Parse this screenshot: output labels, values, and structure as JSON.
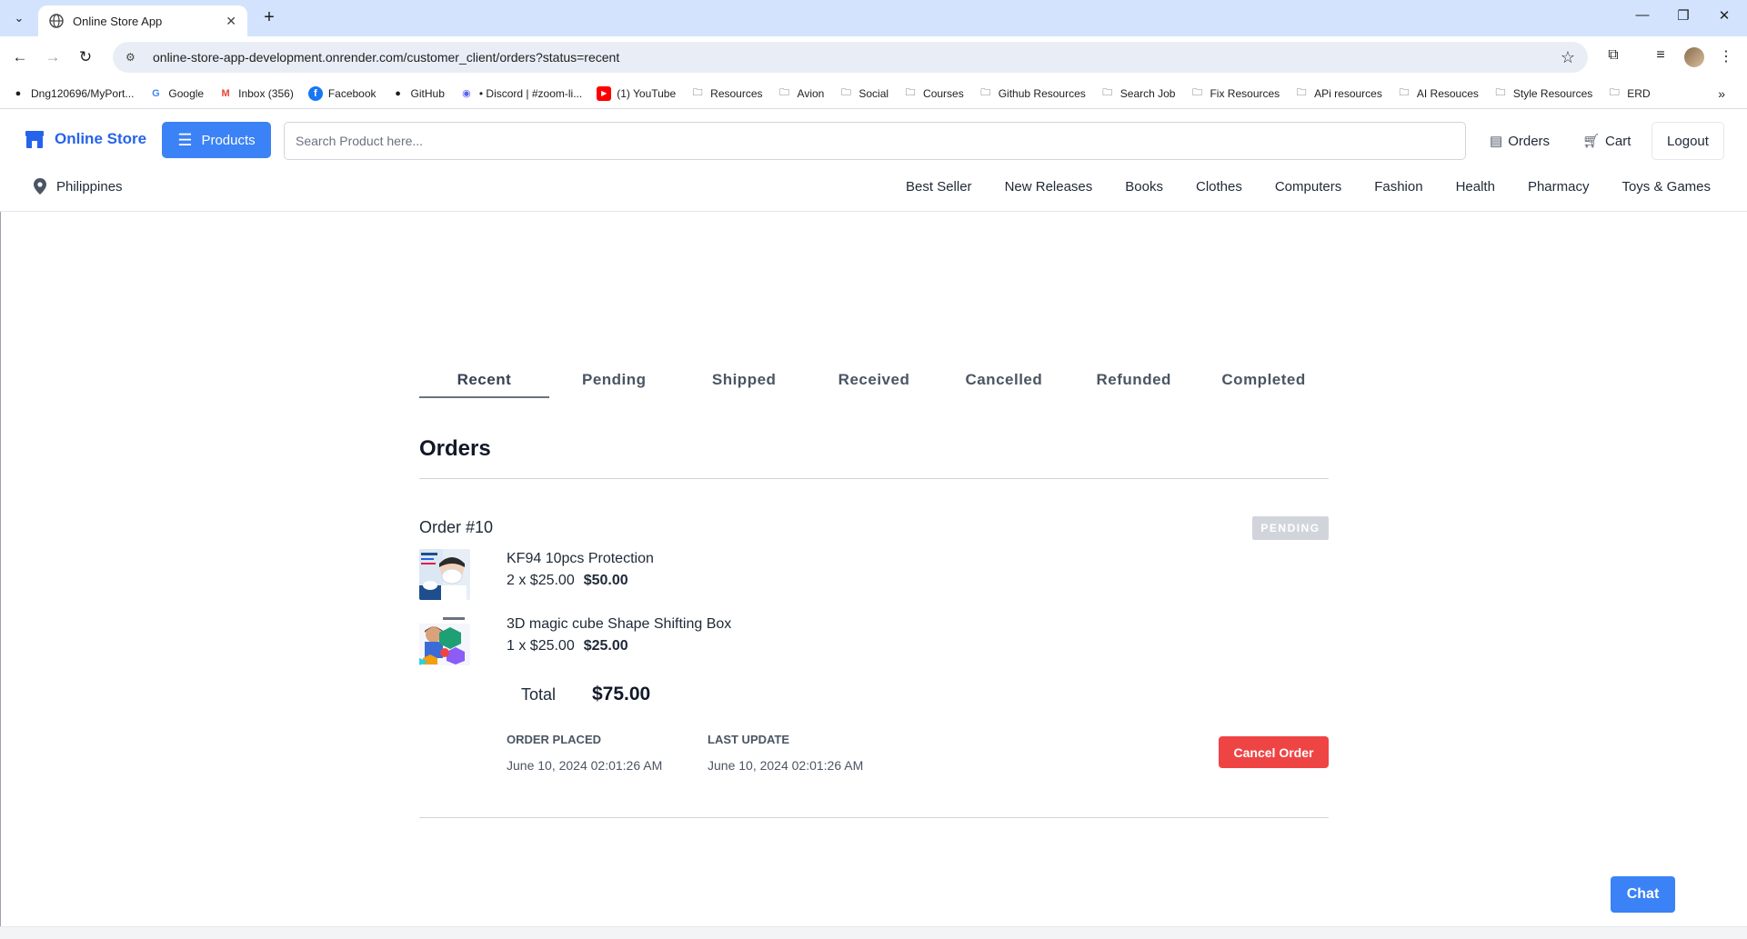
{
  "browser": {
    "tab_title": "Online Store App",
    "url": "online-store-app-development.onrender.com/customer_client/orders?status=recent",
    "bookmarks": [
      {
        "label": "Dng120696/MyPort...",
        "icon": "github-icon"
      },
      {
        "label": "Google",
        "icon": "google-icon"
      },
      {
        "label": "Inbox (356)",
        "icon": "gmail-icon"
      },
      {
        "label": "Facebook",
        "icon": "facebook-icon"
      },
      {
        "label": "GitHub",
        "icon": "github-icon"
      },
      {
        "label": "• Discord | #zoom-li...",
        "icon": "discord-icon"
      },
      {
        "label": "(1) YouTube",
        "icon": "youtube-icon"
      },
      {
        "label": "Resources",
        "icon": "folder-icon"
      },
      {
        "label": "Avion",
        "icon": "folder-icon"
      },
      {
        "label": "Social",
        "icon": "folder-icon"
      },
      {
        "label": "Courses",
        "icon": "folder-icon"
      },
      {
        "label": "Github Resources",
        "icon": "folder-icon"
      },
      {
        "label": "Search Job",
        "icon": "folder-icon"
      },
      {
        "label": "Fix Resources",
        "icon": "folder-icon"
      },
      {
        "label": "APi resources",
        "icon": "folder-icon"
      },
      {
        "label": "AI Resouces",
        "icon": "folder-icon"
      },
      {
        "label": "Style Resources",
        "icon": "folder-icon"
      },
      {
        "label": "ERD",
        "icon": "folder-icon"
      }
    ]
  },
  "header": {
    "brand": "Online Store",
    "products_label": "Products",
    "search_placeholder": "Search Product here...",
    "orders_label": "Orders",
    "cart_label": "Cart",
    "logout_label": "Logout",
    "location": "Philippines",
    "categories": [
      "Best Seller",
      "New Releases",
      "Books",
      "Clothes",
      "Computers",
      "Fashion",
      "Health",
      "Pharmacy",
      "Toys & Games"
    ]
  },
  "orders_page": {
    "tabs": [
      "Recent",
      "Pending",
      "Shipped",
      "Received",
      "Cancelled",
      "Refunded",
      "Completed"
    ],
    "active_tab": "Recent",
    "title": "Orders",
    "order": {
      "number": "Order #10",
      "status": "PENDING",
      "items": [
        {
          "name": "KF94 10pcs Protection",
          "qty_price": "2 x $25.00",
          "subtotal": "$50.00"
        },
        {
          "name": "3D magic cube Shape Shifting Box",
          "qty_price": "1 x $25.00",
          "subtotal": "$25.00"
        }
      ],
      "total_label": "Total",
      "total_value": "$75.00",
      "order_placed_label": "ORDER PLACED",
      "order_placed_value": "June 10, 2024 02:01:26 AM",
      "last_update_label": "LAST UPDATE",
      "last_update_value": "June 10, 2024 02:01:26 AM",
      "cancel_label": "Cancel Order"
    }
  },
  "chat_label": "Chat",
  "colors": {
    "primary": "#3b82f6",
    "brand_text": "#2563eb",
    "danger": "#ef4444",
    "badge_bg": "#d1d5db"
  }
}
